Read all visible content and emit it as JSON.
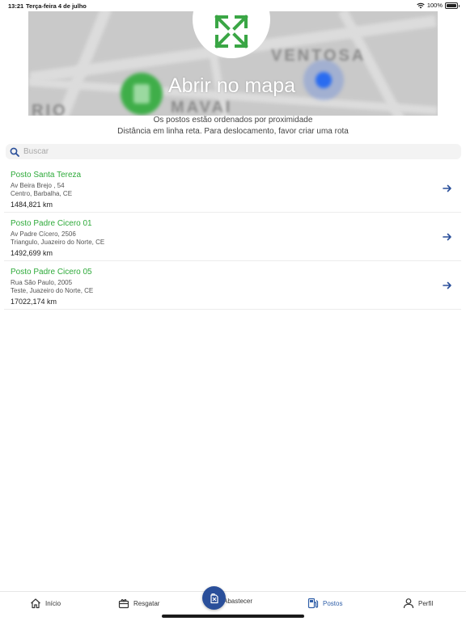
{
  "status_bar": {
    "time": "13:21",
    "date": "Terça-feira 4 de julho",
    "battery": "100%"
  },
  "map": {
    "open_label": "Abrir no mapa",
    "street_labels": [
      "VENTOSA",
      "RIO",
      "MAVAI"
    ]
  },
  "info": {
    "line1": "Os postos estão ordenados por proximidade",
    "line2": "Distância em linha reta. Para deslocamento, favor criar uma rota"
  },
  "search": {
    "placeholder": "Buscar",
    "value": ""
  },
  "stations": [
    {
      "name": "Posto Santa Tereza",
      "address1": "Av Beira Brejo , 54",
      "address2": "Centro, Barbalha, CE",
      "distance": "1484,821 km"
    },
    {
      "name": "Posto Padre Cicero 01",
      "address1": "Av Padre Cícero, 2506",
      "address2": "Triangulo, Juazeiro do Norte, CE",
      "distance": "1492,699 km"
    },
    {
      "name": "Posto Padre Cicero 05",
      "address1": "Rua São Paulo, 2005",
      "address2": "Teste, Juazeiro do Norte, CE",
      "distance": "17022,174 km"
    }
  ],
  "tabs": {
    "inicio": "Início",
    "resgatar": "Resgatar",
    "abastecer": "Abastecer",
    "postos": "Postos",
    "perfil": "Perfil"
  },
  "colors": {
    "accent_green": "#2eaa3a",
    "primary_blue": "#2a4f9a",
    "active_tab": "#2e5ea8"
  },
  "icons": [
    "wifi-icon",
    "battery-icon",
    "expand-arrows-icon",
    "search-icon",
    "arrow-right-icon",
    "home-icon",
    "gift-icon",
    "fuel-can-icon",
    "gas-station-icon",
    "user-icon"
  ]
}
